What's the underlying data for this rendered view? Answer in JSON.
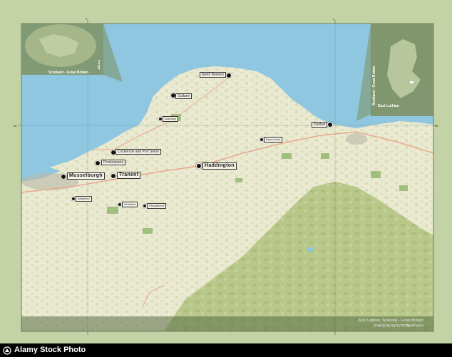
{
  "map": {
    "colors": {
      "sea": "#8ec7df",
      "land": "#f0ecda",
      "green": "#b5cd8f",
      "hills": "#a7b97a",
      "frame": "#c4d3a6",
      "road": "#e7a88c"
    }
  },
  "places": [
    {
      "id": "north-berwick",
      "name": "North Berwick",
      "size": "small"
    },
    {
      "id": "gullane",
      "name": "Gullane",
      "size": "small"
    },
    {
      "id": "aberlady",
      "name": "Aberlady",
      "size": "small"
    },
    {
      "id": "cockenzie",
      "name": "Cockenzie and Port Seton",
      "size": "small"
    },
    {
      "id": "prestonpans",
      "name": "Prestonpans",
      "size": "small"
    },
    {
      "id": "musselburgh",
      "name": "Musselburgh",
      "size": "large"
    },
    {
      "id": "tranent",
      "name": "Tranent",
      "size": "large"
    },
    {
      "id": "haddington",
      "name": "Haddington",
      "size": "large"
    },
    {
      "id": "east-linton",
      "name": "East Linton",
      "size": "small"
    },
    {
      "id": "dunbar",
      "name": "Dunbar",
      "size": "small"
    },
    {
      "id": "wallyford",
      "name": "Wallyford",
      "size": "small"
    },
    {
      "id": "ormiston",
      "name": "Ormiston",
      "size": "small"
    },
    {
      "id": "pencaitland",
      "name": "Pencaitland",
      "size": "small"
    }
  ],
  "insets": {
    "world_label": "Scotland - Great Britain",
    "europe_label": "Europe",
    "scotland_label": "Scotland - Great Britain",
    "region_label": "East Lothian"
  },
  "grid": {
    "lat_label": "56",
    "lon_label": "3",
    "lon_label_2": "2",
    "lat_label_right": "56"
  },
  "caption": {
    "title": "East Lothian, Scotland - Great Britain",
    "coords": "2°46'15\"W  55°57'20\"N",
    "town": "Haddington"
  },
  "footer": {
    "text": "Alamy Stock Photo"
  }
}
